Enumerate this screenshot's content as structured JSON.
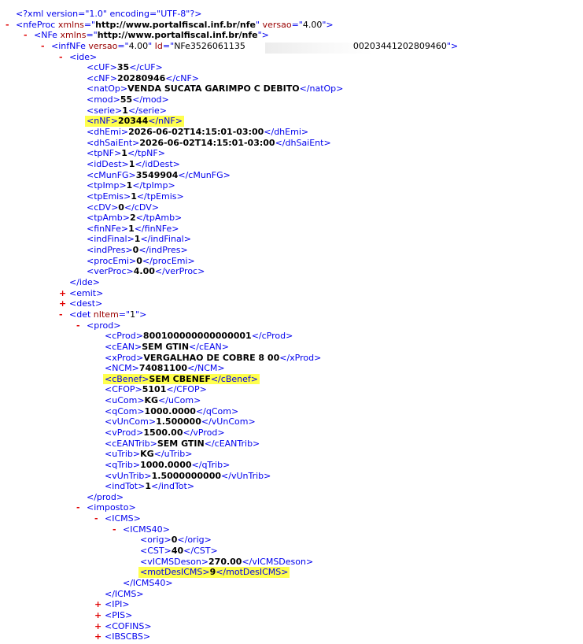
{
  "xml_lines": [
    {
      "indent": 0,
      "toggle": "",
      "segs": [
        [
          "pi",
          "<?xml version=\"1.0\" encoding=\"UTF-8\"?>"
        ]
      ]
    },
    {
      "indent": 0,
      "toggle": "-",
      "segs": [
        [
          "b",
          "<"
        ],
        [
          "b",
          "nfeProc"
        ],
        [
          "an",
          " xmlns"
        ],
        [
          "b",
          "=\""
        ],
        [
          "avb",
          "http://www.portalfiscal.inf.br/nfe"
        ],
        [
          "b",
          "\""
        ],
        [
          "an",
          " versao"
        ],
        [
          "b",
          "=\""
        ],
        [
          "av",
          "4.00"
        ],
        [
          "b",
          "\">"
        ]
      ]
    },
    {
      "indent": 1,
      "toggle": "-",
      "segs": [
        [
          "b",
          "<"
        ],
        [
          "b",
          "NFe"
        ],
        [
          "an",
          " xmlns"
        ],
        [
          "b",
          "=\""
        ],
        [
          "avb",
          "http://www.portalfiscal.inf.br/nfe"
        ],
        [
          "b",
          "\">"
        ]
      ]
    },
    {
      "indent": 2,
      "toggle": "-",
      "segs": [
        [
          "b",
          "<"
        ],
        [
          "b",
          "infNFe"
        ],
        [
          "an",
          " versao"
        ],
        [
          "b",
          "=\""
        ],
        [
          "av",
          "4.00"
        ],
        [
          "b",
          "\""
        ],
        [
          "an",
          " Id"
        ],
        [
          "b",
          "=\""
        ],
        [
          "av",
          "NFe3526061135"
        ],
        [
          "gap",
          ""
        ],
        [
          "av",
          "00203441202809460"
        ],
        [
          "b",
          "\">"
        ]
      ]
    },
    {
      "indent": 3,
      "toggle": "-",
      "segs": [
        [
          "b",
          "<ide>"
        ]
      ]
    },
    {
      "indent": 4,
      "toggle": "",
      "segs": [
        [
          "b",
          "<cUF>"
        ],
        [
          "txt",
          "35"
        ],
        [
          "b",
          "</cUF>"
        ]
      ]
    },
    {
      "indent": 4,
      "toggle": "",
      "segs": [
        [
          "b",
          "<cNF>"
        ],
        [
          "txt",
          "20280946"
        ],
        [
          "b",
          "</cNF>"
        ]
      ]
    },
    {
      "indent": 4,
      "toggle": "",
      "segs": [
        [
          "b",
          "<natOp>"
        ],
        [
          "txt",
          "VENDA SUCATA GARIMPO C DEBITO"
        ],
        [
          "b",
          "</natOp>"
        ]
      ]
    },
    {
      "indent": 4,
      "toggle": "",
      "segs": [
        [
          "b",
          "<mod>"
        ],
        [
          "txt",
          "55"
        ],
        [
          "b",
          "</mod>"
        ]
      ]
    },
    {
      "indent": 4,
      "toggle": "",
      "segs": [
        [
          "b",
          "<serie>"
        ],
        [
          "txt",
          "1"
        ],
        [
          "b",
          "</serie>"
        ]
      ]
    },
    {
      "indent": 4,
      "toggle": "",
      "hl": true,
      "segs": [
        [
          "b",
          "<nNF>"
        ],
        [
          "txt",
          "20344"
        ],
        [
          "b",
          "</nNF>"
        ]
      ]
    },
    {
      "indent": 4,
      "toggle": "",
      "segs": [
        [
          "b",
          "<dhEmi>"
        ],
        [
          "txt",
          "2026-06-02T14:15:01-03:00"
        ],
        [
          "b",
          "</dhEmi>"
        ]
      ]
    },
    {
      "indent": 4,
      "toggle": "",
      "segs": [
        [
          "b",
          "<dhSaiEnt>"
        ],
        [
          "txt",
          "2026-06-02T14:15:01-03:00"
        ],
        [
          "b",
          "</dhSaiEnt>"
        ]
      ]
    },
    {
      "indent": 4,
      "toggle": "",
      "segs": [
        [
          "b",
          "<tpNF>"
        ],
        [
          "txt",
          "1"
        ],
        [
          "b",
          "</tpNF>"
        ]
      ]
    },
    {
      "indent": 4,
      "toggle": "",
      "segs": [
        [
          "b",
          "<idDest>"
        ],
        [
          "txt",
          "1"
        ],
        [
          "b",
          "</idDest>"
        ]
      ]
    },
    {
      "indent": 4,
      "toggle": "",
      "segs": [
        [
          "b",
          "<cMunFG>"
        ],
        [
          "txt",
          "3549904"
        ],
        [
          "b",
          "</cMunFG>"
        ]
      ]
    },
    {
      "indent": 4,
      "toggle": "",
      "segs": [
        [
          "b",
          "<tpImp>"
        ],
        [
          "txt",
          "1"
        ],
        [
          "b",
          "</tpImp>"
        ]
      ]
    },
    {
      "indent": 4,
      "toggle": "",
      "segs": [
        [
          "b",
          "<tpEmis>"
        ],
        [
          "txt",
          "1"
        ],
        [
          "b",
          "</tpEmis>"
        ]
      ]
    },
    {
      "indent": 4,
      "toggle": "",
      "segs": [
        [
          "b",
          "<cDV>"
        ],
        [
          "txt",
          "0"
        ],
        [
          "b",
          "</cDV>"
        ]
      ]
    },
    {
      "indent": 4,
      "toggle": "",
      "segs": [
        [
          "b",
          "<tpAmb>"
        ],
        [
          "txt",
          "2"
        ],
        [
          "b",
          "</tpAmb>"
        ]
      ]
    },
    {
      "indent": 4,
      "toggle": "",
      "segs": [
        [
          "b",
          "<finNFe>"
        ],
        [
          "txt",
          "1"
        ],
        [
          "b",
          "</finNFe>"
        ]
      ]
    },
    {
      "indent": 4,
      "toggle": "",
      "segs": [
        [
          "b",
          "<indFinal>"
        ],
        [
          "txt",
          "1"
        ],
        [
          "b",
          "</indFinal>"
        ]
      ]
    },
    {
      "indent": 4,
      "toggle": "",
      "segs": [
        [
          "b",
          "<indPres>"
        ],
        [
          "txt",
          "0"
        ],
        [
          "b",
          "</indPres>"
        ]
      ]
    },
    {
      "indent": 4,
      "toggle": "",
      "segs": [
        [
          "b",
          "<procEmi>"
        ],
        [
          "txt",
          "0"
        ],
        [
          "b",
          "</procEmi>"
        ]
      ]
    },
    {
      "indent": 4,
      "toggle": "",
      "segs": [
        [
          "b",
          "<verProc>"
        ],
        [
          "txt",
          "4.00"
        ],
        [
          "b",
          "</verProc>"
        ]
      ]
    },
    {
      "indent": 3,
      "toggle": "",
      "segs": [
        [
          "b",
          "</ide>"
        ]
      ]
    },
    {
      "indent": 3,
      "toggle": "+",
      "segs": [
        [
          "b",
          "<emit>"
        ]
      ]
    },
    {
      "indent": 3,
      "toggle": "+",
      "segs": [
        [
          "b",
          "<dest>"
        ]
      ]
    },
    {
      "indent": 3,
      "toggle": "-",
      "segs": [
        [
          "b",
          "<det"
        ],
        [
          "an",
          " nItem"
        ],
        [
          "b",
          "=\""
        ],
        [
          "av",
          "1"
        ],
        [
          "b",
          "\">"
        ]
      ]
    },
    {
      "indent": 4,
      "toggle": "-",
      "segs": [
        [
          "b",
          "<prod>"
        ]
      ]
    },
    {
      "indent": 5,
      "toggle": "",
      "segs": [
        [
          "b",
          "<cProd>"
        ],
        [
          "txt",
          "800100000000000001"
        ],
        [
          "b",
          "</cProd>"
        ]
      ]
    },
    {
      "indent": 5,
      "toggle": "",
      "segs": [
        [
          "b",
          "<cEAN>"
        ],
        [
          "txt",
          "SEM GTIN"
        ],
        [
          "b",
          "</cEAN>"
        ]
      ]
    },
    {
      "indent": 5,
      "toggle": "",
      "segs": [
        [
          "b",
          "<xProd>"
        ],
        [
          "txt",
          "VERGALHAO DE COBRE 8 00"
        ],
        [
          "b",
          "</xProd>"
        ]
      ]
    },
    {
      "indent": 5,
      "toggle": "",
      "segs": [
        [
          "b",
          "<NCM>"
        ],
        [
          "txt",
          "74081100"
        ],
        [
          "b",
          "</NCM>"
        ]
      ]
    },
    {
      "indent": 5,
      "toggle": "",
      "hl": true,
      "segs": [
        [
          "b",
          "<cBenef>"
        ],
        [
          "txt",
          "SEM CBENEF"
        ],
        [
          "b",
          "</cBenef>"
        ]
      ]
    },
    {
      "indent": 5,
      "toggle": "",
      "segs": [
        [
          "b",
          "<CFOP>"
        ],
        [
          "txt",
          "5101"
        ],
        [
          "b",
          "</CFOP>"
        ]
      ]
    },
    {
      "indent": 5,
      "toggle": "",
      "segs": [
        [
          "b",
          "<uCom>"
        ],
        [
          "txt",
          "KG"
        ],
        [
          "b",
          "</uCom>"
        ]
      ]
    },
    {
      "indent": 5,
      "toggle": "",
      "segs": [
        [
          "b",
          "<qCom>"
        ],
        [
          "txt",
          "1000.0000"
        ],
        [
          "b",
          "</qCom>"
        ]
      ]
    },
    {
      "indent": 5,
      "toggle": "",
      "segs": [
        [
          "b",
          "<vUnCom>"
        ],
        [
          "txt",
          "1.500000"
        ],
        [
          "b",
          "</vUnCom>"
        ]
      ]
    },
    {
      "indent": 5,
      "toggle": "",
      "segs": [
        [
          "b",
          "<vProd>"
        ],
        [
          "txt",
          "1500.00"
        ],
        [
          "b",
          "</vProd>"
        ]
      ]
    },
    {
      "indent": 5,
      "toggle": "",
      "segs": [
        [
          "b",
          "<cEANTrib>"
        ],
        [
          "txt",
          "SEM GTIN"
        ],
        [
          "b",
          "</cEANTrib>"
        ]
      ]
    },
    {
      "indent": 5,
      "toggle": "",
      "segs": [
        [
          "b",
          "<uTrib>"
        ],
        [
          "txt",
          "KG"
        ],
        [
          "b",
          "</uTrib>"
        ]
      ]
    },
    {
      "indent": 5,
      "toggle": "",
      "segs": [
        [
          "b",
          "<qTrib>"
        ],
        [
          "txt",
          "1000.0000"
        ],
        [
          "b",
          "</qTrib>"
        ]
      ]
    },
    {
      "indent": 5,
      "toggle": "",
      "segs": [
        [
          "b",
          "<vUnTrib>"
        ],
        [
          "txt",
          "1.5000000000"
        ],
        [
          "b",
          "</vUnTrib>"
        ]
      ]
    },
    {
      "indent": 5,
      "toggle": "",
      "segs": [
        [
          "b",
          "<indTot>"
        ],
        [
          "txt",
          "1"
        ],
        [
          "b",
          "</indTot>"
        ]
      ]
    },
    {
      "indent": 4,
      "toggle": "",
      "segs": [
        [
          "b",
          "</prod>"
        ]
      ]
    },
    {
      "indent": 4,
      "toggle": "-",
      "segs": [
        [
          "b",
          "<imposto>"
        ]
      ]
    },
    {
      "indent": 5,
      "toggle": "-",
      "segs": [
        [
          "b",
          "<ICMS>"
        ]
      ]
    },
    {
      "indent": 6,
      "toggle": "-",
      "segs": [
        [
          "b",
          "<ICMS40>"
        ]
      ]
    },
    {
      "indent": 7,
      "toggle": "",
      "segs": [
        [
          "b",
          "<orig>"
        ],
        [
          "txt",
          "0"
        ],
        [
          "b",
          "</orig>"
        ]
      ]
    },
    {
      "indent": 7,
      "toggle": "",
      "segs": [
        [
          "b",
          "<CST>"
        ],
        [
          "txt",
          "40"
        ],
        [
          "b",
          "</CST>"
        ]
      ]
    },
    {
      "indent": 7,
      "toggle": "",
      "segs": [
        [
          "b",
          "<vICMSDeson>"
        ],
        [
          "txt",
          "270.00"
        ],
        [
          "b",
          "</vICMSDeson>"
        ]
      ]
    },
    {
      "indent": 7,
      "toggle": "",
      "hl": true,
      "segs": [
        [
          "b",
          "<motDesICMS>"
        ],
        [
          "txt",
          "9"
        ],
        [
          "b",
          "</motDesICMS>"
        ]
      ]
    },
    {
      "indent": 6,
      "toggle": "",
      "segs": [
        [
          "b",
          "</ICMS40>"
        ]
      ]
    },
    {
      "indent": 5,
      "toggle": "",
      "segs": [
        [
          "b",
          "</ICMS>"
        ]
      ]
    },
    {
      "indent": 5,
      "toggle": "+",
      "segs": [
        [
          "b",
          "<IPI>"
        ]
      ]
    },
    {
      "indent": 5,
      "toggle": "+",
      "segs": [
        [
          "b",
          "<PIS>"
        ]
      ]
    },
    {
      "indent": 5,
      "toggle": "+",
      "segs": [
        [
          "b",
          "<COFINS>"
        ]
      ]
    },
    {
      "indent": 5,
      "toggle": "+",
      "segs": [
        [
          "b",
          "<IBSCBS>"
        ]
      ]
    }
  ]
}
